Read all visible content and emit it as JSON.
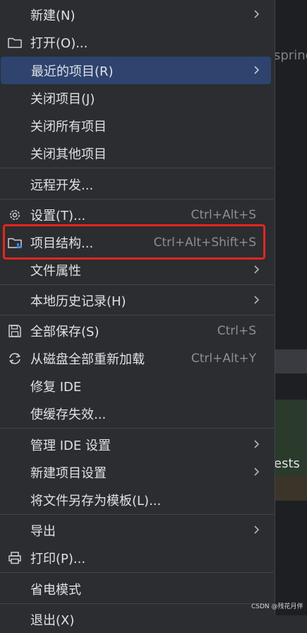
{
  "background": {
    "partial_text_top": "spring",
    "partial_text_bottom": "ests"
  },
  "menu": {
    "items": [
      {
        "id": "new",
        "label": "新建(N)",
        "has_submenu": true
      },
      {
        "id": "open",
        "label": "打开(O)...",
        "icon": "folder-icon"
      },
      {
        "id": "recent",
        "label": "最近的项目(R)",
        "has_submenu": true,
        "highlighted": true
      },
      {
        "id": "close-project",
        "label": "关闭项目(J)"
      },
      {
        "id": "close-all",
        "label": "关闭所有项目"
      },
      {
        "id": "close-others",
        "label": "关闭其他项目"
      },
      {
        "id": "remote-dev",
        "label": "远程开发..."
      },
      {
        "id": "settings",
        "label": "设置(T)...",
        "icon": "gear-icon",
        "shortcut": "Ctrl+Alt+S"
      },
      {
        "id": "project-structure",
        "label": "项目结构...",
        "icon": "project-structure-icon",
        "shortcut": "Ctrl+Alt+Shift+S"
      },
      {
        "id": "file-properties",
        "label": "文件属性",
        "has_submenu": true
      },
      {
        "id": "local-history",
        "label": "本地历史记录(H)",
        "has_submenu": true
      },
      {
        "id": "save-all",
        "label": "全部保存(S)",
        "icon": "save-icon",
        "shortcut": "Ctrl+S"
      },
      {
        "id": "reload",
        "label": "从磁盘全部重新加载",
        "icon": "reload-icon",
        "shortcut": "Ctrl+Alt+Y"
      },
      {
        "id": "repair-ide",
        "label": "修复 IDE"
      },
      {
        "id": "invalidate-caches",
        "label": "使缓存失效..."
      },
      {
        "id": "manage-ide-settings",
        "label": "管理 IDE 设置",
        "has_submenu": true
      },
      {
        "id": "new-project-settings",
        "label": "新建项目设置",
        "has_submenu": true
      },
      {
        "id": "save-as-template",
        "label": "将文件另存为模板(L)..."
      },
      {
        "id": "export",
        "label": "导出",
        "has_submenu": true
      },
      {
        "id": "print",
        "label": "打印(P)...",
        "icon": "printer-icon"
      },
      {
        "id": "power-save",
        "label": "省电模式"
      },
      {
        "id": "exit",
        "label": "退出(X)"
      }
    ]
  },
  "annotation": {
    "highlight_color": "#e3261f",
    "target": "project-structure"
  },
  "colors": {
    "accent": "#2e436e",
    "menu_bg": "#2b2d30",
    "text": "#dfe1e5",
    "shortcut": "#8c8e94"
  },
  "watermark": "CSDN @残花月伴"
}
